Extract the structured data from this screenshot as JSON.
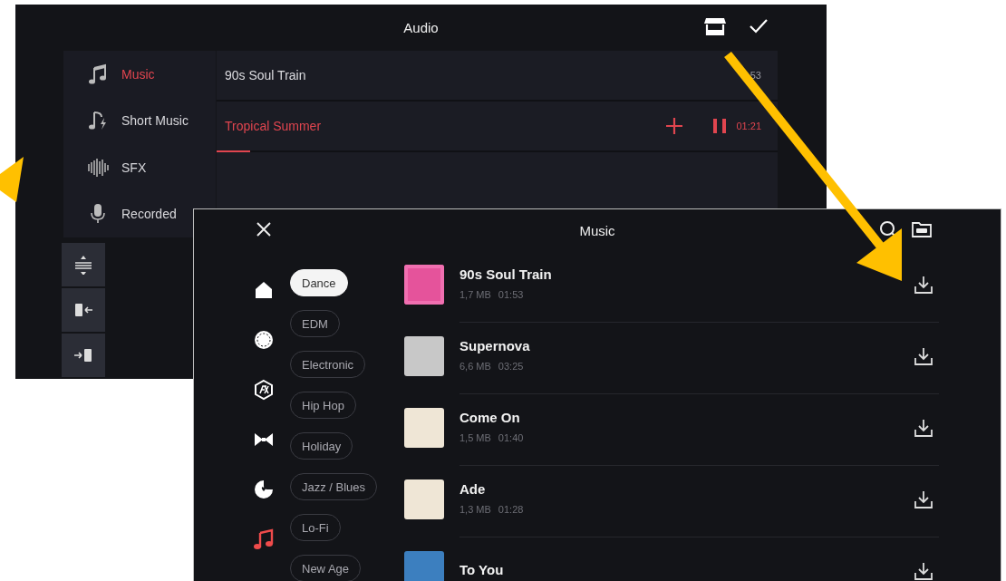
{
  "audio_window": {
    "title": "Audio",
    "categories": [
      {
        "label": "Music",
        "kind": "note",
        "selected": true
      },
      {
        "label": "Short Music",
        "kind": "short",
        "selected": false
      },
      {
        "label": "SFX",
        "kind": "wave",
        "selected": false
      },
      {
        "label": "Recorded",
        "kind": "mic",
        "selected": false
      }
    ],
    "tracks": [
      {
        "title": "90s Soul Train",
        "duration": "53",
        "playing": false
      },
      {
        "title": "Tropical Summer",
        "duration": "01:21",
        "playing": true,
        "level": 0.06
      }
    ]
  },
  "music_window": {
    "title": "Music",
    "sections": [
      {
        "kind": "home",
        "selected": false
      },
      {
        "kind": "new",
        "selected": false
      },
      {
        "kind": "fx",
        "selected": false
      },
      {
        "kind": "bowtie",
        "selected": false
      },
      {
        "kind": "sticker",
        "selected": false
      },
      {
        "kind": "music",
        "selected": true
      }
    ],
    "genres": [
      {
        "label": "Dance",
        "selected": true
      },
      {
        "label": "EDM",
        "selected": false
      },
      {
        "label": "Electronic",
        "selected": false
      },
      {
        "label": "Hip Hop",
        "selected": false
      },
      {
        "label": "Holiday",
        "selected": false
      },
      {
        "label": "Jazz / Blues",
        "selected": false
      },
      {
        "label": "Lo-Fi",
        "selected": false
      },
      {
        "label": "New Age",
        "selected": false
      }
    ],
    "tracks": [
      {
        "title": "90s Soul Train",
        "size": "1,7 MB",
        "duration": "01:53"
      },
      {
        "title": "Supernova",
        "size": "6,6 MB",
        "duration": "03:25"
      },
      {
        "title": "Come On",
        "size": "1,5 MB",
        "duration": "01:40"
      },
      {
        "title": "Ade",
        "size": "1,3 MB",
        "duration": "01:28"
      },
      {
        "title": "To You"
      }
    ]
  }
}
